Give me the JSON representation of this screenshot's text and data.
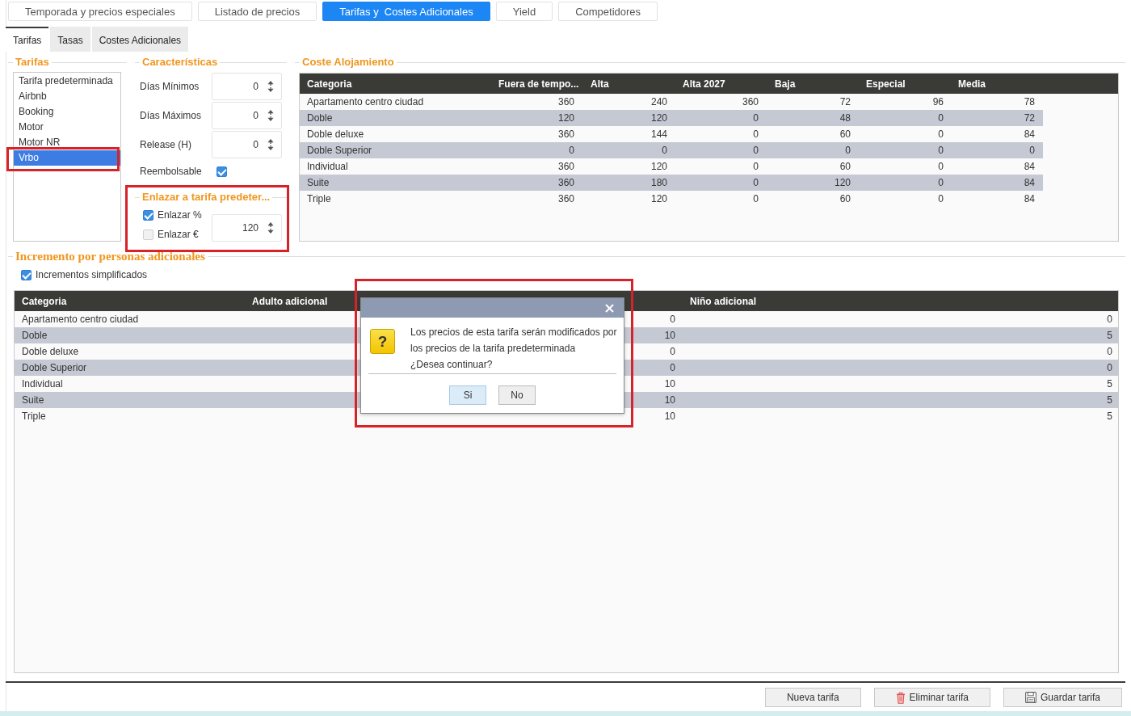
{
  "top_tabs": [
    {
      "label": "Temporada y precios especiales",
      "selected": false
    },
    {
      "label": "Listado de precios",
      "selected": false
    },
    {
      "label": "Tarifas y  Costes Adicionales",
      "selected": true
    },
    {
      "label": "Yield",
      "selected": false
    },
    {
      "label": "Competidores",
      "selected": false
    }
  ],
  "sub_tabs": [
    {
      "label": "Tarifas",
      "selected": true
    },
    {
      "label": "Tasas",
      "selected": false
    },
    {
      "label": "Costes Adicionales",
      "selected": false
    }
  ],
  "tarifas": {
    "title": "Tarifas",
    "items": [
      {
        "label": "Tarifa predeterminada",
        "selected": false,
        "highlighted": false
      },
      {
        "label": "Airbnb",
        "selected": false,
        "highlighted": false
      },
      {
        "label": "Booking",
        "selected": false,
        "highlighted": false
      },
      {
        "label": "Motor",
        "selected": false,
        "highlighted": false
      },
      {
        "label": "Motor NR",
        "selected": false,
        "highlighted": false
      },
      {
        "label": "Vrbo",
        "selected": true,
        "highlighted": true
      }
    ]
  },
  "caracteristicas": {
    "title": "Características",
    "fields": [
      {
        "kind": "spinner",
        "label": "Días Mínimos",
        "value": "0"
      },
      {
        "kind": "spinner",
        "label": "Días Máximos",
        "value": "0"
      },
      {
        "kind": "spinner",
        "label": "Release (H)",
        "value": "0"
      },
      {
        "kind": "checkbox",
        "label": "Reembolsable",
        "checked": true
      }
    ]
  },
  "link_group": {
    "title": "Enlazar a tarifa predeter...",
    "highlighted": true,
    "options": [
      {
        "label": "Enlazar %",
        "checked": true
      },
      {
        "label": "Enlazar €",
        "checked": false
      }
    ],
    "value": "120"
  },
  "coste_alojamiento": {
    "title": "Coste Alojamiento",
    "table": {
      "columns": [
        "Categoria",
        "Fuera de tempo...",
        "Alta",
        "Alta 2027",
        "Baja",
        "Especial",
        "Media"
      ],
      "rows": [
        [
          "Apartamento centro ciudad",
          "360",
          "240",
          "360",
          "72",
          "96",
          "78"
        ],
        [
          "Doble",
          "120",
          "120",
          "0",
          "48",
          "0",
          "72"
        ],
        [
          "Doble deluxe",
          "360",
          "144",
          "0",
          "60",
          "0",
          "84"
        ],
        [
          "Doble Superior",
          "0",
          "0",
          "0",
          "0",
          "0",
          "0"
        ],
        [
          "Individual",
          "360",
          "120",
          "0",
          "60",
          "0",
          "84"
        ],
        [
          "Suite",
          "360",
          "180",
          "0",
          "120",
          "0",
          "84"
        ],
        [
          "Triple",
          "360",
          "120",
          "0",
          "60",
          "0",
          "84"
        ]
      ]
    }
  },
  "incremento": {
    "title": "Incremento por personas adicionales",
    "simplified": {
      "label": "Incrementos simplificados",
      "checked": true
    },
    "table": {
      "columns": [
        "Categoria",
        "Adulto adicional",
        "Niño adicional"
      ],
      "rows": [
        [
          "Apartamento centro ciudad",
          "0",
          "0"
        ],
        [
          "Doble",
          "10",
          "5"
        ],
        [
          "Doble deluxe",
          "0",
          "0"
        ],
        [
          "Doble Superior",
          "0",
          "0"
        ],
        [
          "Individual",
          "10",
          "5"
        ],
        [
          "Suite",
          "10",
          "5"
        ],
        [
          "Triple",
          "10",
          "5"
        ]
      ]
    }
  },
  "dialog": {
    "highlighted": true,
    "icon_glyph": "?",
    "message": [
      "Los precios de esta tarifa serán modificados por los precios de la tarifa predeterminada",
      "¿Desea continuar?"
    ],
    "buttons": [
      {
        "label": "Si",
        "selected": true
      },
      {
        "label": "No",
        "selected": false
      }
    ]
  },
  "footer_buttons": [
    {
      "kind": "plain",
      "label": "Nueva tarifa"
    },
    {
      "kind": "delete",
      "label": "Eliminar tarifa"
    },
    {
      "kind": "save",
      "label": "Guardar tarifa"
    }
  ]
}
